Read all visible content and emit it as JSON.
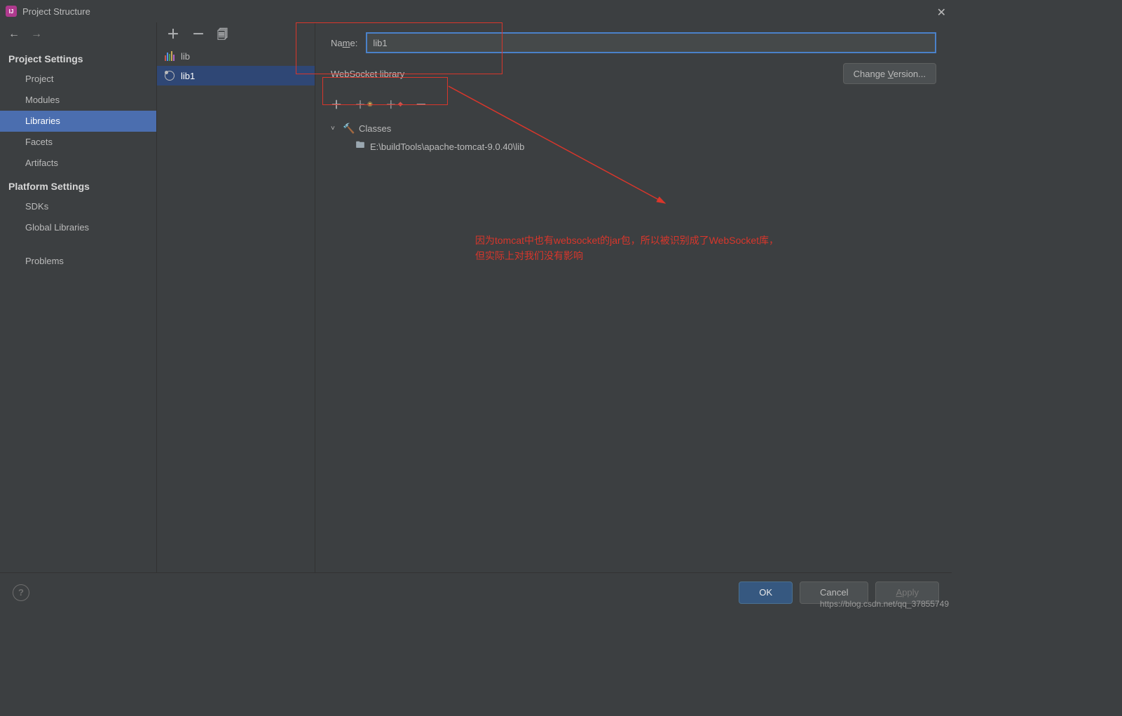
{
  "window": {
    "title": "Project Structure"
  },
  "sidebar": {
    "section1_title": "Project Settings",
    "section1_items": [
      "Project",
      "Modules",
      "Libraries",
      "Facets",
      "Artifacts"
    ],
    "section1_selected": 2,
    "section2_title": "Platform Settings",
    "section2_items": [
      "SDKs",
      "Global Libraries"
    ],
    "section3_items": [
      "Problems"
    ]
  },
  "library_list": {
    "items": [
      {
        "name": "lib",
        "icon": "bars"
      },
      {
        "name": "lib1",
        "icon": "websocket"
      }
    ],
    "selected": 1
  },
  "detail": {
    "name_label_prefix": "Na",
    "name_label_underline": "m",
    "name_label_suffix": "e:",
    "name_value": "lib1",
    "subtype": "WebSocket library",
    "change_version_prefix": "Change ",
    "change_version_underline": "V",
    "change_version_suffix": "ersion...",
    "tree": {
      "classes_label": "Classes",
      "path": "E:\\buildTools\\apache-tomcat-9.0.40\\lib"
    }
  },
  "annotation": {
    "line1": "因为tomcat中也有websocket的jar包，所以被识别成了WebSocket库，",
    "line2": "但实际上对我们没有影响"
  },
  "footer": {
    "ok": "OK",
    "cancel": "Cancel",
    "apply_underline": "A",
    "apply_rest": "pply"
  },
  "watermark": "https://blog.csdn.net/qq_37855749"
}
